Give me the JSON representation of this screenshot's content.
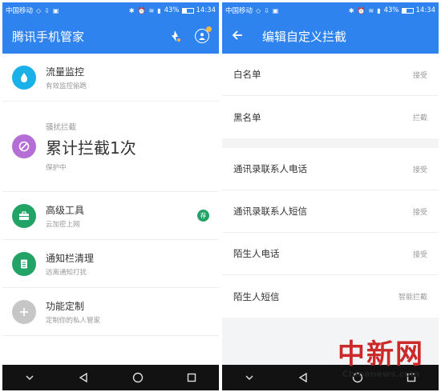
{
  "left": {
    "status": {
      "carrier": "中国移动",
      "battery": "43%",
      "time": "14:34"
    },
    "app_title": "腾讯手机管家",
    "items": [
      {
        "title": "流量监控",
        "sub": "有效监控偷跑",
        "icon": "water-drop-icon",
        "color": "#1ab0e8"
      },
      {
        "title": "高级工具",
        "sub": "云加密上网",
        "icon": "toolbox-icon",
        "color": "#21a366",
        "badge": "荐"
      },
      {
        "title": "通知栏清理",
        "sub": "远离通知打扰",
        "icon": "notification-clean-icon",
        "color": "#21a366"
      },
      {
        "title": "功能定制",
        "sub": "定制你的私人管家",
        "icon": "plus-icon",
        "color": "#c6c6c6"
      }
    ],
    "intercept": {
      "label": "骚扰拦截",
      "count": "累计拦截1次",
      "status": "保护中",
      "icon": "block-icon",
      "color": "#b56ed6"
    }
  },
  "right": {
    "status": {
      "carrier": "中国移动",
      "battery": "43%",
      "time": "14:34"
    },
    "title": "编辑自定义拦截",
    "group1": [
      {
        "label": "白名单",
        "value": "接受"
      },
      {
        "label": "黑名单",
        "value": "拦截"
      }
    ],
    "group2": [
      {
        "label": "通讯录联系人电话",
        "value": "接受"
      },
      {
        "label": "通讯录联系人短信",
        "value": "接受"
      },
      {
        "label": "陌生人电话",
        "value": "接受"
      },
      {
        "label": "陌生人短信",
        "value": "智能拦截"
      }
    ]
  },
  "watermark": {
    "cn": "中新网",
    "en": "Chinanews.com"
  },
  "colors": {
    "accent": "#2f83ee",
    "navbar": "#121212"
  }
}
